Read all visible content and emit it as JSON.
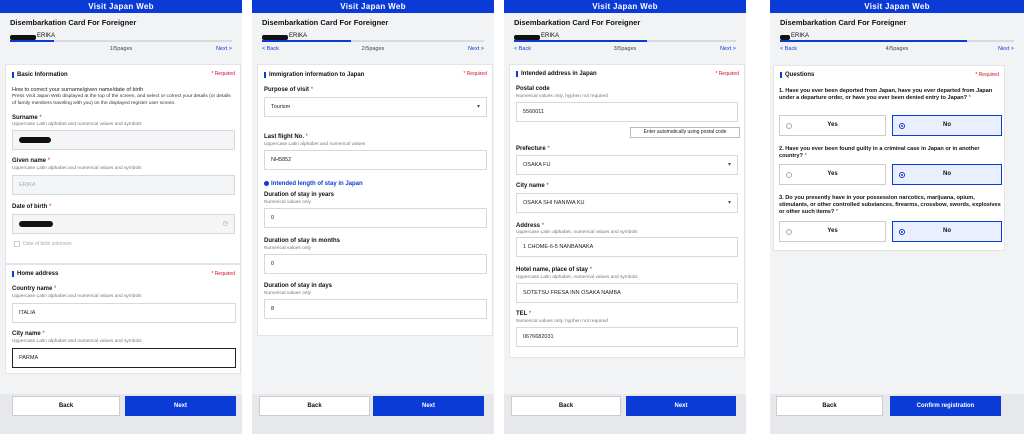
{
  "app_title": "Visit Japan Web",
  "form_title": "Disembarkation Card For Foreigner",
  "given_name": "ERIKA",
  "nav": {
    "back": "< Back",
    "next": "Next >"
  },
  "footer": {
    "back": "Back",
    "next": "Next",
    "confirm": "Confirm registration"
  },
  "required": "* Required",
  "colors": {
    "primary": "#0b3bd6",
    "required": "#d0112b"
  },
  "screen1": {
    "page": "1/5pages",
    "section_basic": "Basic Information",
    "how_title": "How to correct your surname/given name/date of birth",
    "how_text": "Press Visit Japan Web displayed at the top of the screen, and select or correct your details (or details of family members traveling with you) on the displayed register user screen.",
    "surname_label": "Surname",
    "surname_hint": "Uppercase Latin alphabet and numerical values and symbols",
    "given_label": "Given name",
    "given_hint": "Uppercase Latin alphabet and numerical values and symbols",
    "given_value": "ERIKA",
    "dob_label": "Date of birth",
    "dob_unknown": "Date of birth unknown",
    "section_home": "Home address",
    "country_label": "Country name",
    "country_hint": "Uppercase Latin alphabet and numerical values and symbols",
    "country_value": "ITALIA",
    "city_label": "City name",
    "city_hint": "Uppercase Latin alphabet and numerical values and symbols",
    "city_value": "PARMA"
  },
  "screen2": {
    "page": "2/5pages",
    "section": "Immigration information to Japan",
    "purpose_label": "Purpose of visit",
    "purpose_value": "Tourism",
    "flight_label": "Last flight No.",
    "flight_hint": "Uppercase Latin alphabet and numerical values",
    "flight_value": "NH5852",
    "intended_label": "Intended length of stay in Japan",
    "years_label": "Duration of stay in years",
    "years_hint": "Numerical values only",
    "years_value": "0",
    "months_label": "Duration of stay in months",
    "months_hint": "Numerical values only",
    "months_value": "0",
    "days_label": "Duration of stay in days",
    "days_hint": "Numerical values only",
    "days_value": "8"
  },
  "screen3": {
    "page": "3/5pages",
    "section": "Intended address in Japan",
    "postal_label": "Postal code",
    "postal_hint": "Numerical values only, hyphen not required",
    "postal_value": "5560011",
    "auto_btn": "Enter automatically using postal code",
    "pref_label": "Prefecture",
    "pref_value": "OSAKA FU",
    "city_label": "City name",
    "city_value": "OSAKA SHI NANIWA KU",
    "address_label": "Address",
    "address_hint": "Uppercase Latin alphabet, numerical values and symbols",
    "address_value": "1 CHOME-6-5 NANBANAKA",
    "hotel_label": "Hotel name, place of stay",
    "hotel_hint": "Uppercase Latin alphabet, numerical values and symbols",
    "hotel_value": "SOTETSU FRESA INN OSAKA NAMBA",
    "tel_label": "TEL",
    "tel_hint": "Numerical values only, hyphen not required",
    "tel_value": "0676682031"
  },
  "screen4": {
    "page": "4/5pages",
    "section": "Questions",
    "q1": "1. Have you ever been deported from Japan, have you ever departed from Japan under a departure order, or have you ever been denied entry to Japan?",
    "q2": "2. Have you ever been found guilty in a criminal case in Japan or in another country?",
    "q3": "3. Do you presently have in your possession narcotics, marijuana, opium, stimulants, or other controlled substances, firearms, crossbow, swords, explosives or other such items?",
    "yes": "Yes",
    "no": "No"
  }
}
